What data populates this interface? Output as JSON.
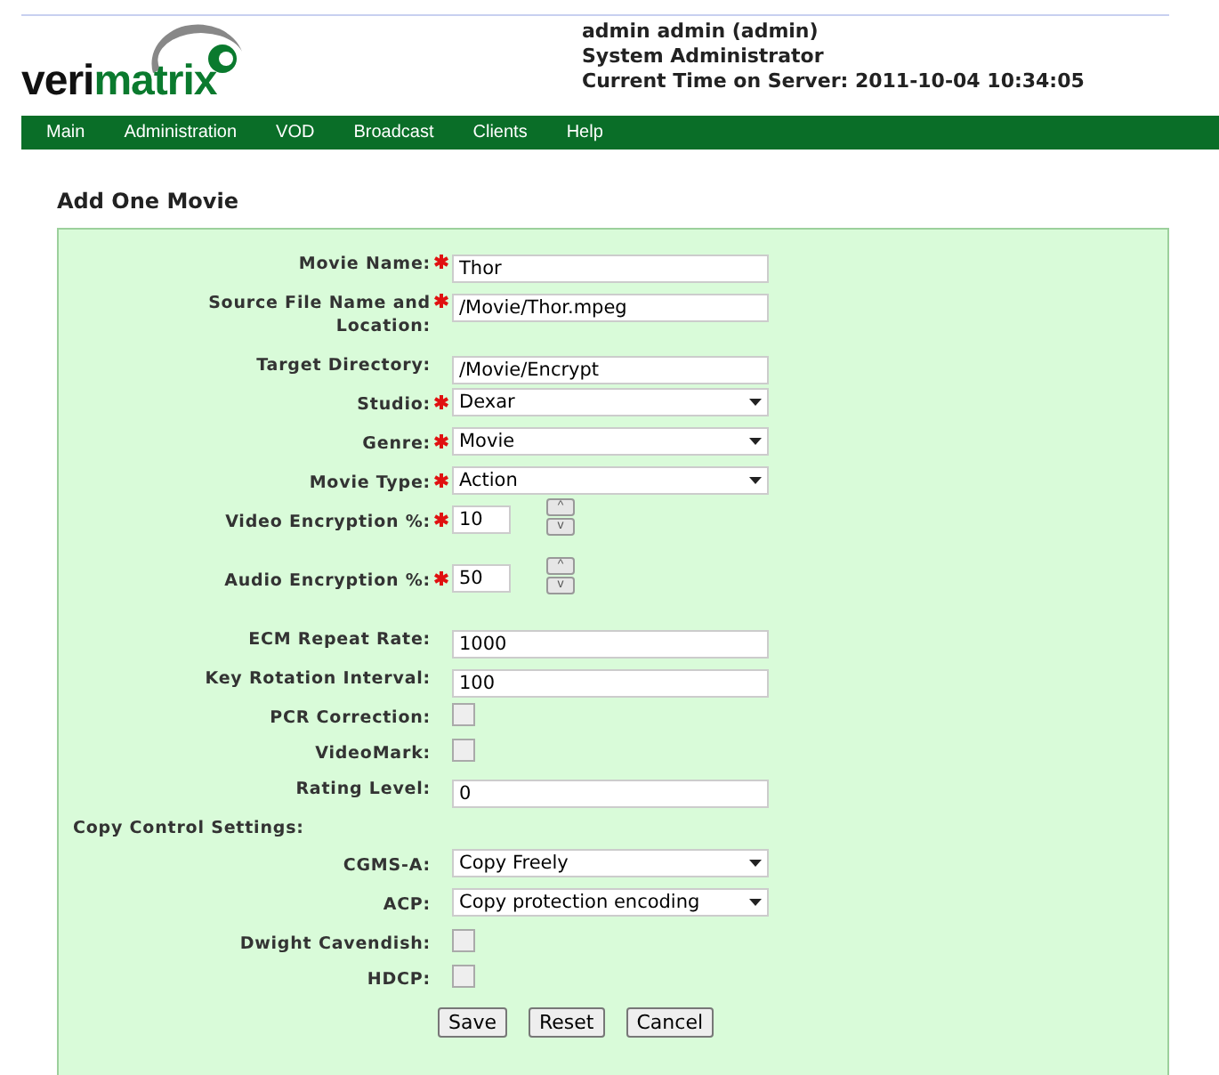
{
  "header": {
    "logo": {
      "part_1": "veri",
      "part_2": "matrix"
    },
    "user": "admin admin (admin)",
    "role": "System Administrator",
    "server_time": "Current Time on Server: 2011-10-04 10:34:05"
  },
  "nav": [
    "Main",
    "Administration",
    "VOD",
    "Broadcast",
    "Clients",
    "Help"
  ],
  "title": "Add One Movie",
  "fields": [
    {
      "kind": "text",
      "label": "Movie Name:",
      "required": true,
      "value": "Thor"
    },
    {
      "kind": "text",
      "label": "Source File Name and Location:",
      "required": true,
      "value": "/Movie/Thor.mpeg"
    },
    {
      "kind": "text",
      "label": "Target Directory:",
      "required": false,
      "value": "/Movie/Encrypt"
    },
    {
      "kind": "select",
      "label": "Studio:",
      "required": true,
      "value": "Dexar"
    },
    {
      "kind": "select",
      "label": "Genre:",
      "required": true,
      "value": "Movie"
    },
    {
      "kind": "select",
      "label": "Movie Type:",
      "required": true,
      "value": "Action"
    },
    {
      "kind": "spinner",
      "label": "Video Encryption %:",
      "required": true,
      "value": "10",
      "up": "^",
      "down": "v"
    },
    {
      "kind": "spinner",
      "label": "Audio Encryption %:",
      "required": true,
      "value": "50",
      "up": "^",
      "down": "v"
    },
    {
      "kind": "text",
      "label": "ECM Repeat Rate:",
      "required": false,
      "value": "1000"
    },
    {
      "kind": "text",
      "label": "Key Rotation Interval:",
      "required": false,
      "value": "100"
    },
    {
      "kind": "checkbox",
      "label": "PCR Correction:",
      "required": false,
      "checked": false
    },
    {
      "kind": "checkbox",
      "label": "VideoMark:",
      "required": false,
      "checked": false
    },
    {
      "kind": "text",
      "label": "Rating Level:",
      "required": false,
      "value": "0"
    },
    {
      "kind": "heading",
      "label": "Copy Control Settings:"
    },
    {
      "kind": "select",
      "label": "CGMS-A:",
      "required": false,
      "value": "Copy Freely"
    },
    {
      "kind": "select",
      "label": "ACP:",
      "required": false,
      "value": "Copy protection encoding"
    },
    {
      "kind": "checkbox",
      "label": "Dwight Cavendish:",
      "required": false,
      "checked": false
    },
    {
      "kind": "checkbox",
      "label": "HDCP:",
      "required": false,
      "checked": false
    }
  ],
  "buttons": [
    "Save",
    "Reset",
    "Cancel"
  ]
}
